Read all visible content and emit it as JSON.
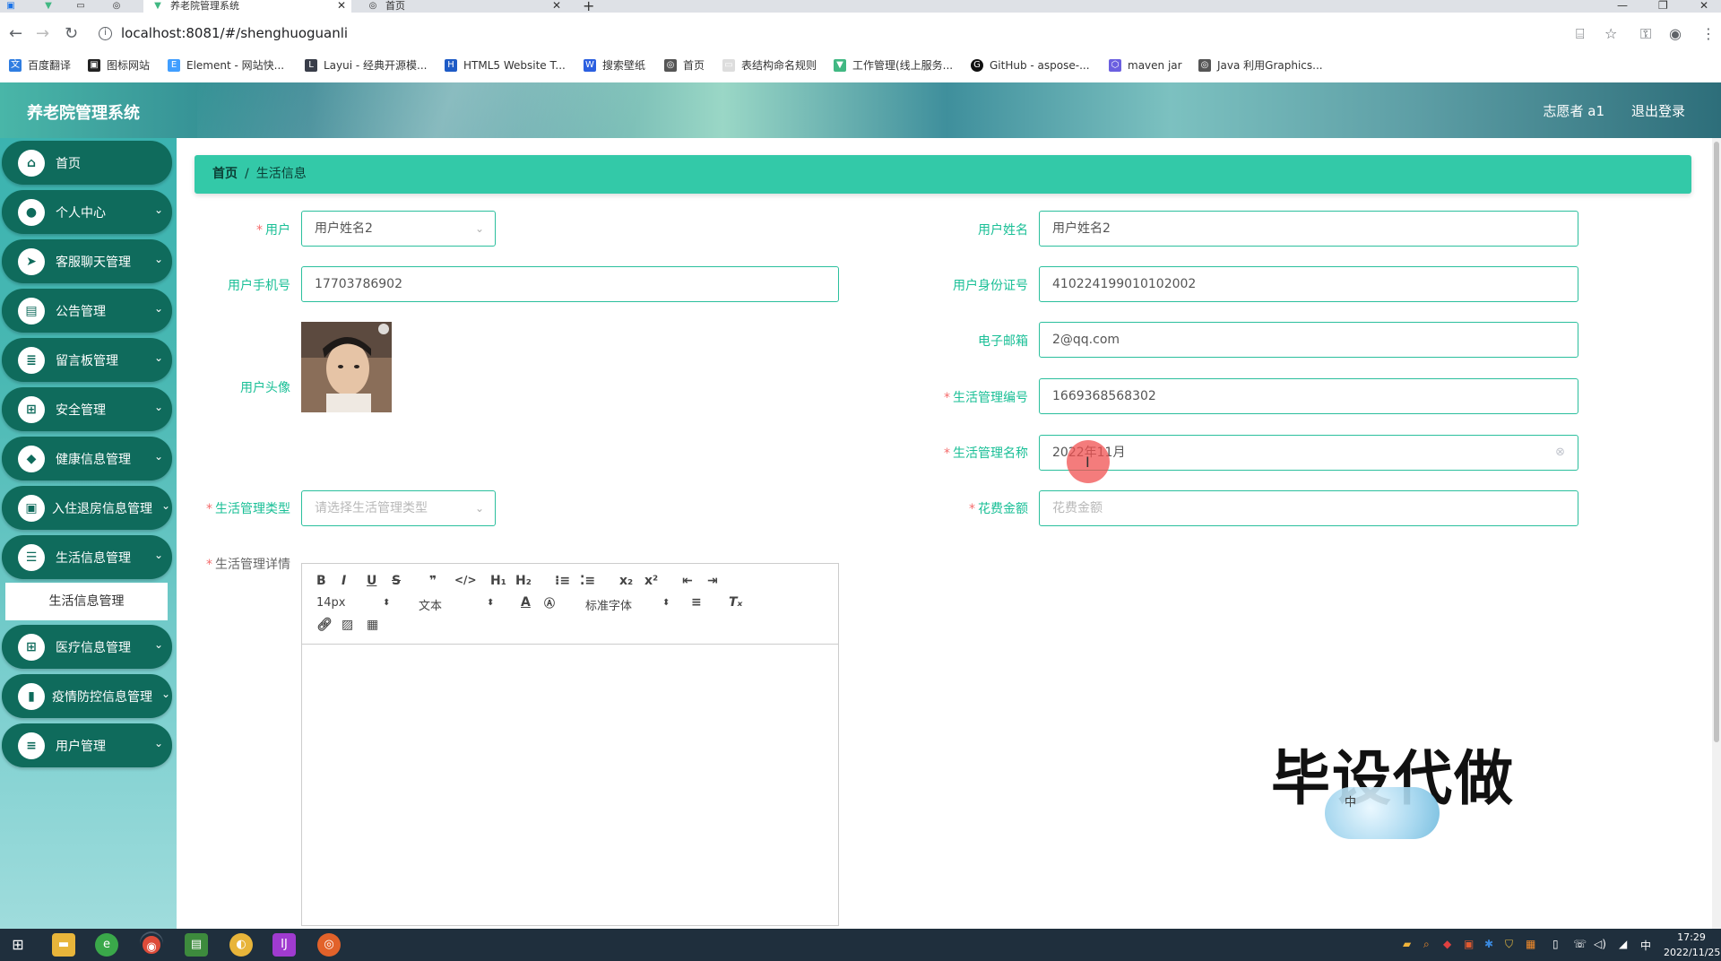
{
  "browser": {
    "tabs": [
      {
        "title": "养老院管理系统",
        "active": true
      },
      {
        "title": "首页",
        "active": false
      }
    ],
    "url": "localhost:8081/#/shenghuoguanli",
    "bookmarks": [
      "百度翻译",
      "图标网站",
      "Element - 网站快...",
      "Layui - 经典开源模...",
      "HTML5 Website T...",
      "搜索壁纸",
      "首页",
      "表结构命名规则",
      "工作管理(线上服务...",
      "GitHub - aspose-...",
      "maven jar",
      "Java 利用Graphics..."
    ]
  },
  "header": {
    "title": "养老院管理系统",
    "user": "志愿者 a1",
    "logout": "退出登录"
  },
  "sidebar": {
    "items": [
      {
        "label": "首页",
        "icon": "home-icon"
      },
      {
        "label": "个人中心",
        "icon": "user-icon"
      },
      {
        "label": "客服聊天管理",
        "icon": "send-icon"
      },
      {
        "label": "公告管理",
        "icon": "briefcase-icon"
      },
      {
        "label": "留言板管理",
        "icon": "document-icon"
      },
      {
        "label": "安全管理",
        "icon": "grid-icon"
      },
      {
        "label": "健康信息管理",
        "icon": "location-icon"
      },
      {
        "label": "入住退房信息管理",
        "icon": "image-icon"
      },
      {
        "label": "生活信息管理",
        "icon": "list-icon"
      },
      {
        "label": "医疗信息管理",
        "icon": "grid-icon"
      },
      {
        "label": "疫情防控信息管理",
        "icon": "video-icon"
      },
      {
        "label": "用户管理",
        "icon": "sliders-icon"
      }
    ],
    "subitem": "生活信息管理"
  },
  "breadcrumb": {
    "home": "首页",
    "current": "生活信息"
  },
  "form": {
    "user": {
      "label": "用户",
      "value": "用户姓名2"
    },
    "user_name": {
      "label": "用户姓名",
      "value": "用户姓名2"
    },
    "user_phone": {
      "label": "用户手机号",
      "value": "17703786902"
    },
    "user_idcard": {
      "label": "用户身份证号",
      "value": "410224199010102002"
    },
    "email": {
      "label": "电子邮箱",
      "value": "2@qq.com"
    },
    "avatar": {
      "label": "用户头像"
    },
    "life_code": {
      "label": "生活管理编号",
      "value": "1669368568302"
    },
    "life_name": {
      "label": "生活管理名称",
      "value": "2022年11月"
    },
    "life_type": {
      "label": "生活管理类型",
      "placeholder": "请选择生活管理类型"
    },
    "cost": {
      "label": "花费金额",
      "placeholder": "花费金额"
    },
    "detail": {
      "label": "生活管理详情"
    }
  },
  "editor": {
    "font_size": "14px",
    "text_type": "文本",
    "font_family": "标准字体"
  },
  "watermark": {
    "text": "毕设代做",
    "small": "中"
  },
  "taskbar": {
    "time": "17:29",
    "date": "2022/11/25",
    "ime": "中"
  },
  "colors": {
    "accent": "#19bf96",
    "sidebar_item": "#0f6b5c",
    "breadcrumb": "#33c9a8",
    "required": "#f56c6c"
  }
}
